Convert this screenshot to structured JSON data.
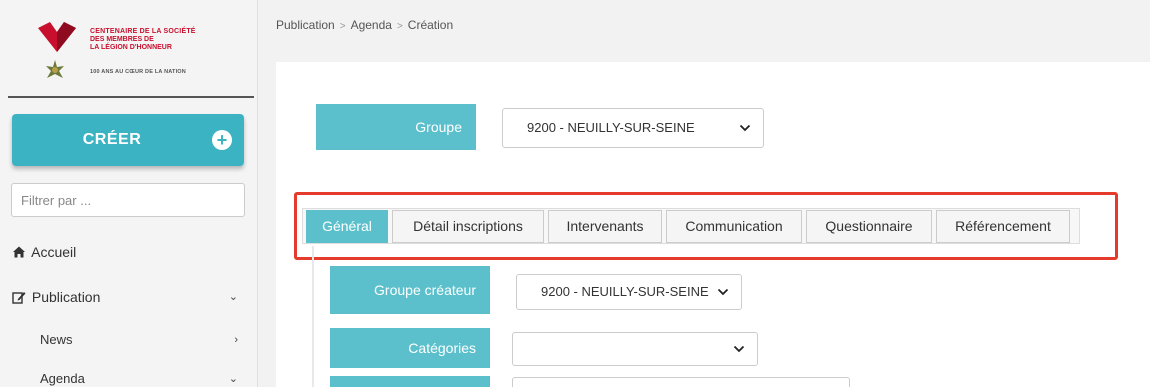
{
  "logo": {
    "line1": "CENTENAIRE DE LA SOCIÉTÉ",
    "line2": "DES MEMBRES DE",
    "line3": "LA LÉGION D'HONNEUR",
    "tagline": "100 ANS AU CŒUR DE LA NATION"
  },
  "sidebar": {
    "create_label": "CRÉER",
    "filter_placeholder": "Filtrer par ...",
    "items": [
      {
        "label": "Accueil",
        "icon": "home-icon"
      },
      {
        "label": "Publication",
        "icon": "edit-icon"
      },
      {
        "label": "News"
      },
      {
        "label": "Agenda"
      }
    ]
  },
  "breadcrumb": [
    "Publication",
    "Agenda",
    "Création"
  ],
  "group": {
    "label": "Groupe",
    "value": "9200 - NEUILLY-SUR-SEINE"
  },
  "tabs": [
    "Général",
    "Détail inscriptions",
    "Intervenants",
    "Communication",
    "Questionnaire",
    "Référencement"
  ],
  "form": {
    "creator_group": {
      "label": "Groupe créateur",
      "value": "9200 - NEUILLY-SUR-SEINE"
    },
    "categories": {
      "label": "Catégories",
      "value": ""
    }
  },
  "colors": {
    "accent": "#5bc0cc",
    "button": "#3bb3c3",
    "highlight": "#e53b2c",
    "brand_red": "#c8102e"
  }
}
